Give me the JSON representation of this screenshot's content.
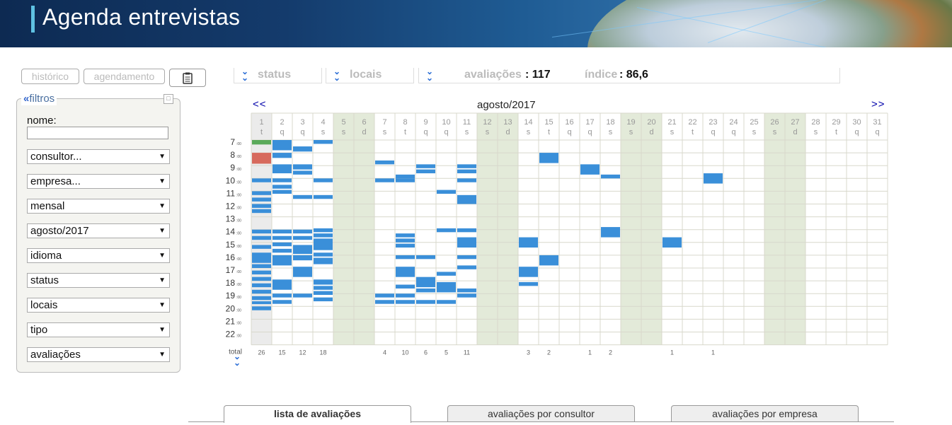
{
  "app": {
    "title": "Agenda entrevistas"
  },
  "toolbar": {
    "historico_label": "histórico",
    "agendamento_label": "agendamento",
    "clipboard_icon": "clipboard-icon"
  },
  "filters": {
    "header_label": "filtros",
    "nome_label": "nome:",
    "nome_value": "",
    "selects": [
      "consultor...",
      "empresa...",
      "mensal",
      "agosto/2017",
      "idioma",
      "status",
      "locais",
      "tipo",
      "avaliações"
    ]
  },
  "summary": {
    "status_label": "status",
    "locais_label": "locais",
    "avaliacoes_label": "avaliações",
    "avaliacoes_value": ": 117",
    "indice_label": "índice",
    "indice_value": ": 86,6"
  },
  "calendar": {
    "month_label": "agosto/2017",
    "prev_label": "<<",
    "next_label": ">>",
    "days": [
      "1",
      "2",
      "3",
      "4",
      "5",
      "6",
      "7",
      "8",
      "9",
      "10",
      "11",
      "12",
      "13",
      "14",
      "15",
      "16",
      "17",
      "18",
      "19",
      "20",
      "21",
      "22",
      "23",
      "24",
      "25",
      "26",
      "27",
      "28",
      "29",
      "30",
      "31"
    ],
    "weekdays": [
      "t",
      "q",
      "q",
      "s",
      "s",
      "d",
      "s",
      "t",
      "q",
      "q",
      "s",
      "s",
      "d",
      "s",
      "t",
      "q",
      "q",
      "s",
      "s",
      "d",
      "s",
      "t",
      "q",
      "q",
      "s",
      "s",
      "d",
      "s",
      "t",
      "q",
      "q"
    ],
    "weekend_days": [
      5,
      6,
      12,
      13,
      19,
      20,
      26,
      27
    ],
    "hours": [
      "7",
      "8",
      "9",
      "10",
      "11",
      "12",
      "13",
      "14",
      "15",
      "16",
      "17",
      "18",
      "19",
      "20",
      "21",
      "22"
    ],
    "hour_suffix": ":00",
    "total_label": "total",
    "totals": [
      "26",
      "15",
      "12",
      "18",
      "",
      "",
      "4",
      "10",
      "6",
      "5",
      "11",
      "",
      "",
      "3",
      "2",
      "",
      "1",
      "2",
      "",
      "",
      "1",
      "",
      "1",
      "",
      "",
      "",
      "",
      "",
      "",
      "",
      ""
    ],
    "colors": {
      "event": "#3a8fd9",
      "weekend": "#e3ead9",
      "grid": "#d8d8cc",
      "today": "#ebebeb",
      "confirmed": "#5aaa5a",
      "cancelled": "#d76a5d"
    },
    "events": [
      {
        "day": 1,
        "start": 7.0,
        "end": 7.35,
        "status": "confirmed"
      },
      {
        "day": 1,
        "start": 8.0,
        "end": 8.85,
        "status": "cancelled"
      },
      {
        "day": 1,
        "start": 10.0,
        "end": 10.3
      },
      {
        "day": 1,
        "start": 11.0,
        "end": 11.3
      },
      {
        "day": 1,
        "start": 11.5,
        "end": 11.8
      },
      {
        "day": 1,
        "start": 12.0,
        "end": 12.3
      },
      {
        "day": 1,
        "start": 12.4,
        "end": 12.7
      },
      {
        "day": 1,
        "start": 14.0,
        "end": 14.3
      },
      {
        "day": 1,
        "start": 14.5,
        "end": 14.8
      },
      {
        "day": 1,
        "start": 15.2,
        "end": 15.5
      },
      {
        "day": 1,
        "start": 15.8,
        "end": 16.6
      },
      {
        "day": 1,
        "start": 16.7,
        "end": 17.0
      },
      {
        "day": 1,
        "start": 17.2,
        "end": 17.5
      },
      {
        "day": 1,
        "start": 17.7,
        "end": 18.0
      },
      {
        "day": 1,
        "start": 18.2,
        "end": 18.5
      },
      {
        "day": 1,
        "start": 18.7,
        "end": 19.0
      },
      {
        "day": 1,
        "start": 19.2,
        "end": 19.5
      },
      {
        "day": 1,
        "start": 19.6,
        "end": 19.8
      },
      {
        "day": 1,
        "start": 20.0,
        "end": 20.3
      },
      {
        "day": 2,
        "start": 7.0,
        "end": 7.8
      },
      {
        "day": 2,
        "start": 8.0,
        "end": 8.4
      },
      {
        "day": 2,
        "start": 8.9,
        "end": 9.6
      },
      {
        "day": 2,
        "start": 10.0,
        "end": 10.3
      },
      {
        "day": 2,
        "start": 10.5,
        "end": 10.8
      },
      {
        "day": 2,
        "start": 10.9,
        "end": 11.2
      },
      {
        "day": 2,
        "start": 14.0,
        "end": 14.3
      },
      {
        "day": 2,
        "start": 14.5,
        "end": 14.8
      },
      {
        "day": 2,
        "start": 15.0,
        "end": 15.3
      },
      {
        "day": 2,
        "start": 15.5,
        "end": 15.8
      },
      {
        "day": 2,
        "start": 16.0,
        "end": 16.8
      },
      {
        "day": 2,
        "start": 17.9,
        "end": 18.7
      },
      {
        "day": 2,
        "start": 19.0,
        "end": 19.3
      },
      {
        "day": 2,
        "start": 19.5,
        "end": 19.8
      },
      {
        "day": 3,
        "start": 7.5,
        "end": 7.9
      },
      {
        "day": 3,
        "start": 8.9,
        "end": 9.3
      },
      {
        "day": 3,
        "start": 9.4,
        "end": 9.7
      },
      {
        "day": 3,
        "start": 11.3,
        "end": 11.6
      },
      {
        "day": 3,
        "start": 14.0,
        "end": 14.3
      },
      {
        "day": 3,
        "start": 14.5,
        "end": 14.8
      },
      {
        "day": 3,
        "start": 15.2,
        "end": 15.9
      },
      {
        "day": 3,
        "start": 16.0,
        "end": 16.4
      },
      {
        "day": 3,
        "start": 16.9,
        "end": 17.7
      },
      {
        "day": 3,
        "start": 19.0,
        "end": 19.3
      },
      {
        "day": 4,
        "start": 7.0,
        "end": 7.3
      },
      {
        "day": 4,
        "start": 10.0,
        "end": 10.3
      },
      {
        "day": 4,
        "start": 11.3,
        "end": 11.6
      },
      {
        "day": 4,
        "start": 13.9,
        "end": 14.2
      },
      {
        "day": 4,
        "start": 14.3,
        "end": 14.6
      },
      {
        "day": 4,
        "start": 14.7,
        "end": 15.6
      },
      {
        "day": 4,
        "start": 15.8,
        "end": 16.1
      },
      {
        "day": 4,
        "start": 16.2,
        "end": 16.7
      },
      {
        "day": 4,
        "start": 17.9,
        "end": 18.3
      },
      {
        "day": 4,
        "start": 18.4,
        "end": 18.7
      },
      {
        "day": 4,
        "start": 18.8,
        "end": 19.1
      },
      {
        "day": 4,
        "start": 19.3,
        "end": 19.6
      },
      {
        "day": 7,
        "start": 8.6,
        "end": 8.9
      },
      {
        "day": 7,
        "start": 10.0,
        "end": 10.3
      },
      {
        "day": 7,
        "start": 19.0,
        "end": 19.3
      },
      {
        "day": 7,
        "start": 19.5,
        "end": 19.8
      },
      {
        "day": 8,
        "start": 9.7,
        "end": 10.0
      },
      {
        "day": 8,
        "start": 10.0,
        "end": 10.3
      },
      {
        "day": 8,
        "start": 14.3,
        "end": 14.6
      },
      {
        "day": 8,
        "start": 14.7,
        "end": 15.0
      },
      {
        "day": 8,
        "start": 15.1,
        "end": 15.4
      },
      {
        "day": 8,
        "start": 16.0,
        "end": 16.3
      },
      {
        "day": 8,
        "start": 16.9,
        "end": 17.7
      },
      {
        "day": 8,
        "start": 18.3,
        "end": 18.6
      },
      {
        "day": 8,
        "start": 19.0,
        "end": 19.3
      },
      {
        "day": 8,
        "start": 19.5,
        "end": 19.8
      },
      {
        "day": 9,
        "start": 8.9,
        "end": 9.2
      },
      {
        "day": 9,
        "start": 9.3,
        "end": 9.6
      },
      {
        "day": 9,
        "start": 16.0,
        "end": 16.3
      },
      {
        "day": 9,
        "start": 17.7,
        "end": 18.5
      },
      {
        "day": 9,
        "start": 18.6,
        "end": 18.9
      },
      {
        "day": 9,
        "start": 19.5,
        "end": 19.8
      },
      {
        "day": 10,
        "start": 10.9,
        "end": 11.2
      },
      {
        "day": 10,
        "start": 13.9,
        "end": 14.2
      },
      {
        "day": 10,
        "start": 17.3,
        "end": 17.6
      },
      {
        "day": 10,
        "start": 18.1,
        "end": 18.9
      },
      {
        "day": 10,
        "start": 19.5,
        "end": 19.8
      },
      {
        "day": 11,
        "start": 8.9,
        "end": 9.2
      },
      {
        "day": 11,
        "start": 9.3,
        "end": 9.6
      },
      {
        "day": 11,
        "start": 10.0,
        "end": 10.3
      },
      {
        "day": 11,
        "start": 11.3,
        "end": 12.0
      },
      {
        "day": 11,
        "start": 13.9,
        "end": 14.2
      },
      {
        "day": 11,
        "start": 14.6,
        "end": 15.4
      },
      {
        "day": 11,
        "start": 16.0,
        "end": 16.3
      },
      {
        "day": 11,
        "start": 16.8,
        "end": 17.1
      },
      {
        "day": 11,
        "start": 18.6,
        "end": 18.9
      },
      {
        "day": 11,
        "start": 19.0,
        "end": 19.3
      },
      {
        "day": 14,
        "start": 14.6,
        "end": 15.4
      },
      {
        "day": 14,
        "start": 16.9,
        "end": 17.7
      },
      {
        "day": 14,
        "start": 18.1,
        "end": 18.4
      },
      {
        "day": 15,
        "start": 8.0,
        "end": 8.8
      },
      {
        "day": 15,
        "start": 16.0,
        "end": 16.8
      },
      {
        "day": 17,
        "start": 8.9,
        "end": 9.7
      },
      {
        "day": 18,
        "start": 9.7,
        "end": 10.0
      },
      {
        "day": 18,
        "start": 13.8,
        "end": 14.6
      },
      {
        "day": 21,
        "start": 14.6,
        "end": 15.4
      },
      {
        "day": 23,
        "start": 9.6,
        "end": 10.4
      }
    ]
  },
  "tabs": [
    "lista de avaliações",
    "avaliações por consultor",
    "avaliações por empresa"
  ]
}
